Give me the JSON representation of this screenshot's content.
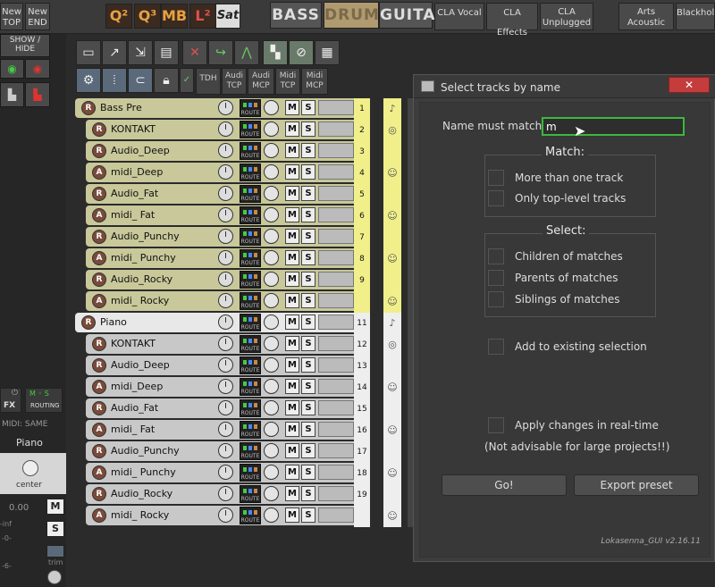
{
  "toolbar": {
    "new_top": "New\nTOP",
    "new_end": "New\nEND",
    "show_hide": "SHOW /\nHIDE",
    "presets": [
      "Q²",
      "Q³",
      "MB",
      "L²",
      "Sat"
    ],
    "instrument_tabs": [
      "BASS",
      "DRUMS",
      "GUITAR"
    ],
    "text_buttons": [
      "CLA Vocal",
      "CLA Effects",
      "CLA\nUnplugged",
      "Arts\nAcoustic",
      "Blackhol"
    ]
  },
  "actionbar": {
    "labels": [
      "TDH",
      "Audi\nTCP",
      "Audi\nMCP",
      "Midi\nTCP",
      "Midi\nMCP"
    ]
  },
  "tracks": [
    {
      "name": "Bass Pre",
      "type": "folder",
      "icon": "R",
      "num": "1",
      "group": "bass"
    },
    {
      "name": "KONTAKT",
      "type": "audio",
      "icon": "R",
      "num": "2",
      "group": "bass"
    },
    {
      "name": "Audio_Deep",
      "type": "audio",
      "icon": "R",
      "num": "3",
      "group": "bass"
    },
    {
      "name": "midi_Deep",
      "type": "midi",
      "icon": "A",
      "num": "4",
      "group": "bass"
    },
    {
      "name": "Audio_Fat",
      "type": "audio",
      "icon": "R",
      "num": "5",
      "group": "bass"
    },
    {
      "name": "midi_ Fat",
      "type": "midi",
      "icon": "A",
      "num": "6",
      "group": "bass"
    },
    {
      "name": "Audio_Punchy",
      "type": "audio",
      "icon": "R",
      "num": "7",
      "group": "bass"
    },
    {
      "name": "midi_ Punchy",
      "type": "midi",
      "icon": "A",
      "num": "8",
      "group": "bass"
    },
    {
      "name": "Audio_Rocky",
      "type": "audio",
      "icon": "R",
      "num": "9",
      "group": "bass"
    },
    {
      "name": "midi_ Rocky",
      "type": "midi",
      "icon": "A",
      "num": "",
      "group": "bass"
    },
    {
      "name": "Piano",
      "type": "folder",
      "icon": "R",
      "num": "11",
      "group": "piano"
    },
    {
      "name": "KONTAKT",
      "type": "audio",
      "icon": "R",
      "num": "12",
      "group": "piano"
    },
    {
      "name": "Audio_Deep",
      "type": "audio",
      "icon": "R",
      "num": "13",
      "group": "piano"
    },
    {
      "name": "midi_Deep",
      "type": "midi",
      "icon": "A",
      "num": "14",
      "group": "piano"
    },
    {
      "name": "Audio_Fat",
      "type": "audio",
      "icon": "R",
      "num": "15",
      "group": "piano"
    },
    {
      "name": "midi_ Fat",
      "type": "midi",
      "icon": "A",
      "num": "16",
      "group": "piano"
    },
    {
      "name": "Audio_Punchy",
      "type": "audio",
      "icon": "R",
      "num": "17",
      "group": "piano"
    },
    {
      "name": "midi_ Punchy",
      "type": "midi",
      "icon": "A",
      "num": "18",
      "group": "piano"
    },
    {
      "name": "Audio_Rocky",
      "type": "audio",
      "icon": "R",
      "num": "19",
      "group": "piano"
    },
    {
      "name": "midi_ Rocky",
      "type": "midi",
      "icon": "A",
      "num": "",
      "group": "piano"
    }
  ],
  "track_buttons": {
    "route": "ROUTE",
    "mute": "M",
    "solo": "S"
  },
  "mixer": {
    "fx": "FX",
    "routing": "ROUTING",
    "midi_label": "MIDI: SAME",
    "track_name": "Piano",
    "pan_label": "center",
    "volume": "0.00",
    "mute": "M",
    "solo": "S",
    "inf": "-inf",
    "scale_0": "-0-",
    "scale_6": "-6-",
    "trim": "trim"
  },
  "dialog": {
    "title": "Select tracks by name",
    "close": "✕",
    "name_label": "Name must match:",
    "name_value": "m",
    "match_title": "Match:",
    "match_options": [
      "More than one track",
      "Only top-level tracks"
    ],
    "select_title": "Select:",
    "select_options": [
      "Children of matches",
      "Parents of matches",
      "Siblings of matches"
    ],
    "add_existing": "Add to existing selection",
    "apply_realtime": "Apply changes in real-time",
    "realtime_note": "(Not advisable for large projects!!)",
    "go_button": "Go!",
    "export_button": "Export preset",
    "version": "Lokasenna_GUI v2.16.11"
  },
  "colors": {
    "bass_track_bg": "#c8c89a",
    "piano_track_bg": "#c8c8c8",
    "bass_num_bg": "#f0ef8a",
    "input_border": "#3cb83c",
    "close_red": "#c43c3c"
  }
}
